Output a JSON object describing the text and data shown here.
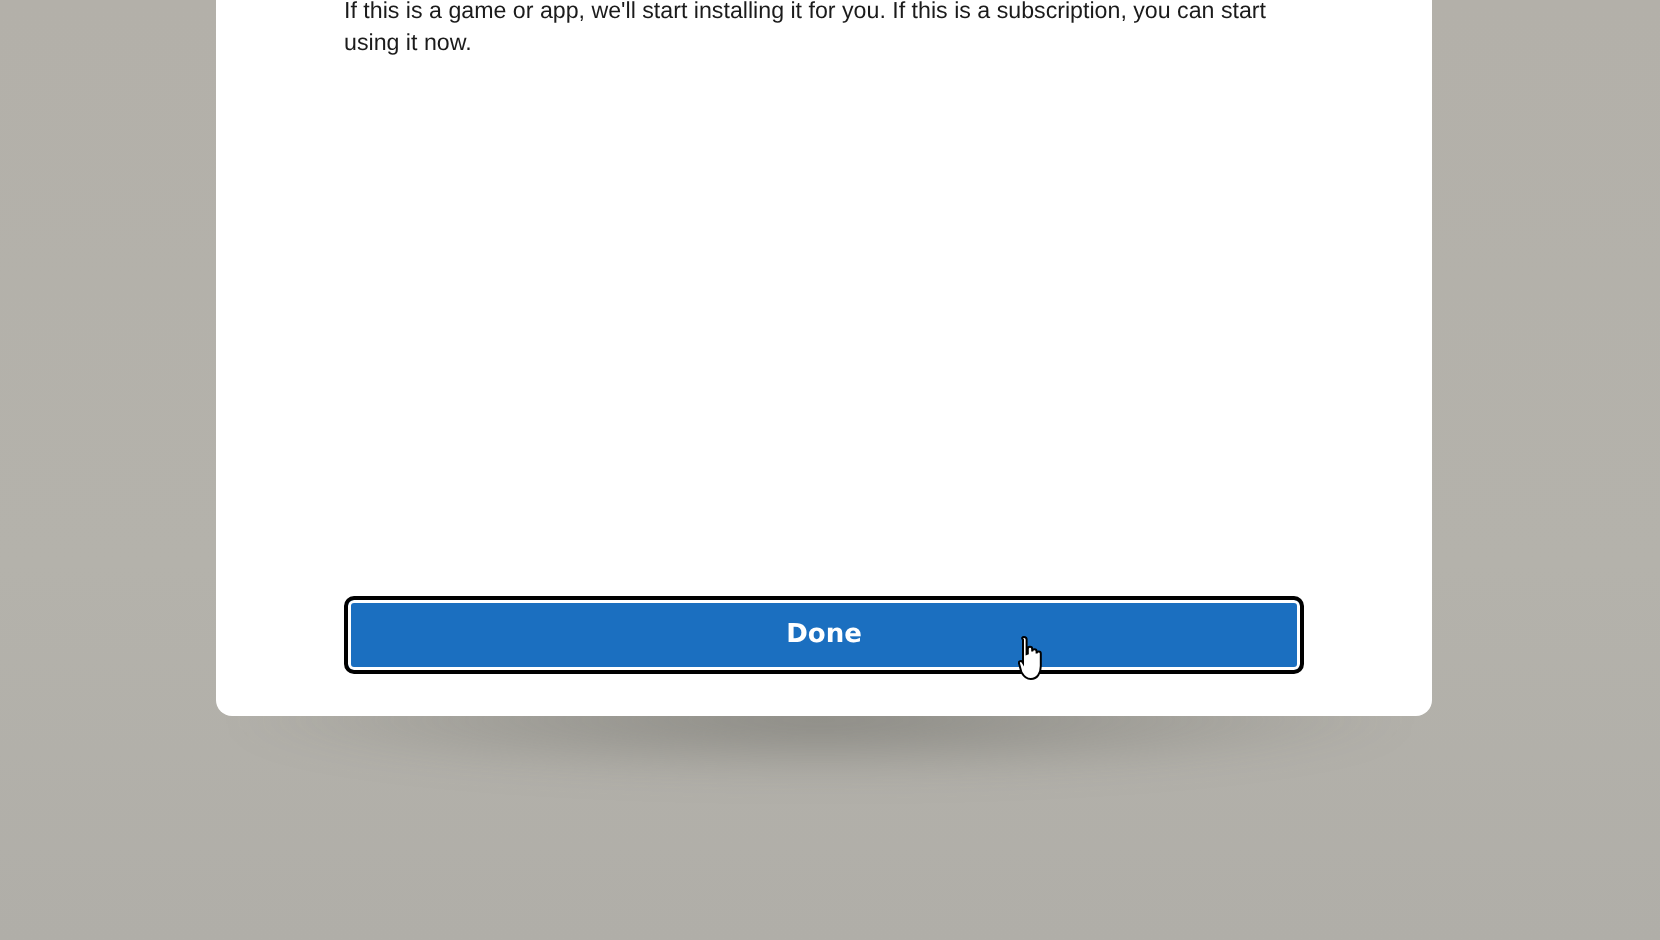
{
  "dialog": {
    "message": "If this is a game or app, we'll start installing it for you. If this is a subscription, you can start using it now.",
    "button": {
      "label": "Done",
      "focused": true
    }
  }
}
